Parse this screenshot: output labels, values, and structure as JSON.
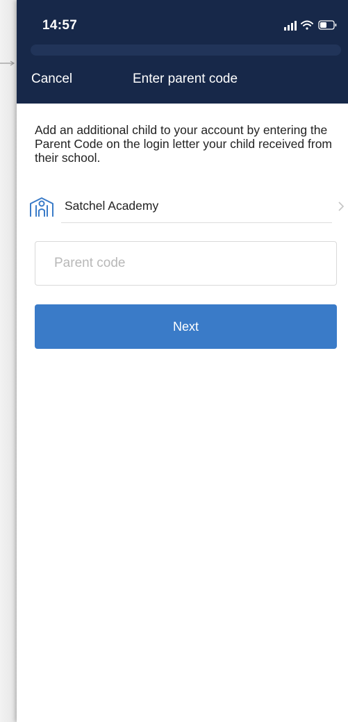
{
  "status_bar": {
    "time": "14:57"
  },
  "nav": {
    "cancel_label": "Cancel",
    "title": "Enter parent code"
  },
  "intro_text": "Add an additional child to your account by entering the Parent Code on the login letter your child received from their school.",
  "school": {
    "name": "Satchel Academy",
    "icon": "school-building-icon"
  },
  "parent_code_field": {
    "value": "",
    "placeholder": "Parent code"
  },
  "next_button": {
    "label": "Next"
  },
  "colors": {
    "header": "#172849",
    "accent": "#3a7bc8",
    "icon": "#3a7bc8"
  }
}
